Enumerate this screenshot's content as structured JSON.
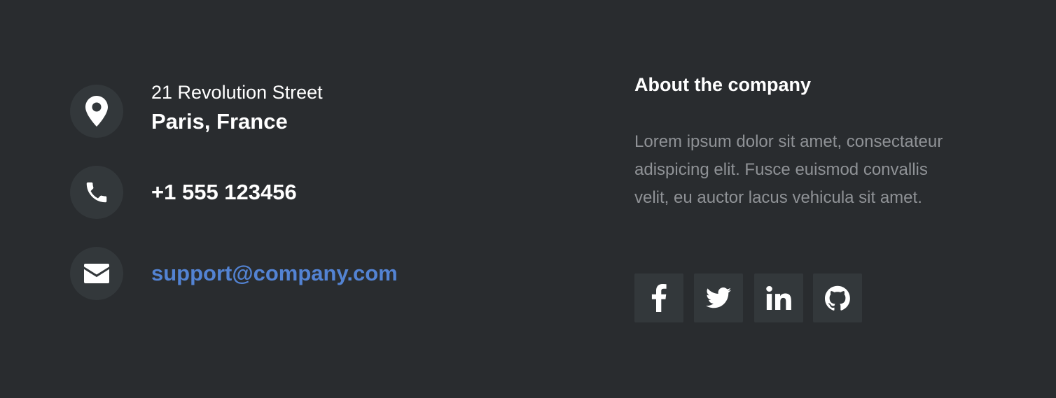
{
  "contact": {
    "address": {
      "line1": "21 Revolution Street",
      "line2": "Paris, France",
      "icon": "map-marker-icon"
    },
    "phone": {
      "text": "+1 555 123456",
      "icon": "phone-icon"
    },
    "email": {
      "text": "support@company.com",
      "icon": "envelope-icon"
    }
  },
  "about": {
    "title": "About the company",
    "text": "Lorem ipsum dolor sit amet, consectateur adispicing elit. Fusce euismod convallis velit, eu auctor lacus vehicula sit amet."
  },
  "social": [
    {
      "name": "facebook",
      "icon": "facebook-icon"
    },
    {
      "name": "twitter",
      "icon": "twitter-icon"
    },
    {
      "name": "linkedin",
      "icon": "linkedin-icon"
    },
    {
      "name": "github",
      "icon": "github-icon"
    }
  ],
  "colors": {
    "background": "#292c2f",
    "icon_background": "#33383b",
    "link": "#5383d3",
    "muted_text": "#8f9296",
    "text": "#ffffff"
  }
}
